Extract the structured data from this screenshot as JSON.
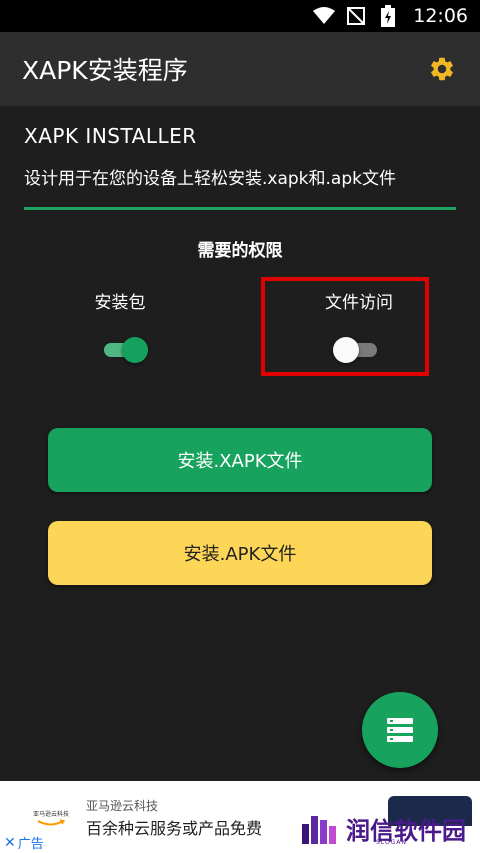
{
  "status_bar": {
    "time": "12:06",
    "icons": [
      "wifi-icon",
      "no-signal-icon",
      "battery-charging-icon"
    ]
  },
  "app_bar": {
    "title": "XAPK安装程序",
    "settings_icon": "gear-icon"
  },
  "main": {
    "heading": "XAPK INSTALLER",
    "subtitle": "设计用于在您的设备上轻松安装.xapk和.apk文件",
    "permissions_title": "需要的权限",
    "permissions": [
      {
        "label": "安装包",
        "enabled": true
      },
      {
        "label": "文件访问",
        "enabled": false
      }
    ],
    "install_xapk_label": "安装.XAPK文件",
    "install_apk_label": "安装.APK文件",
    "fab_icon": "list-icon"
  },
  "ad": {
    "logo_text": "亚马逊云科技",
    "sponsor": "亚马逊云科技",
    "title": "百余种云服务或产品免费",
    "close_label": "广告"
  },
  "watermark": {
    "text": "润信软件园",
    "slogan": "SLOGAN"
  },
  "colors": {
    "accent_green": "#17a35e",
    "accent_yellow": "#fed657",
    "highlight_red": "#e00000",
    "app_bar": "#2e2e2e",
    "background": "#1e1e1e"
  }
}
